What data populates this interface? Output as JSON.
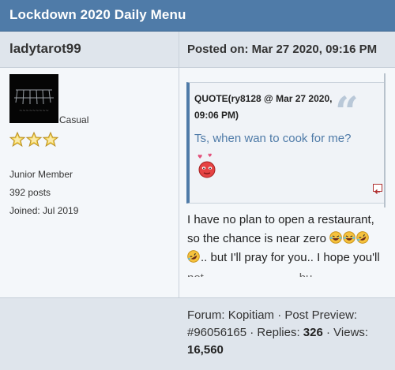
{
  "thread": {
    "title": "Lockdown 2020 Daily Menu"
  },
  "post": {
    "username": "ladytarot99",
    "posted_label": "Posted on: Mar 27 2020, 09:16 PM",
    "rank": "Casual",
    "member_group": "Junior Member",
    "post_count": "392 posts",
    "joined": "Joined: Jul 2019",
    "quote": {
      "header": "QUOTE(ry8128 @ Mar 27 2020, 09:06 PM)",
      "text": "Ts, when wan to cook for me?",
      "quote_icon": "quote-mark-icon",
      "expand_icon": "expand-icon"
    },
    "message": {
      "line1": "I have no plan to open a restaurant,",
      "line2": "so the chance is near zero",
      "line3": ".. but I'll pray for you.. I hope you'll",
      "cut_line": "not ... ... ... ... ... ... ... bu..."
    },
    "rating_stars": 3,
    "rating_max": 3
  },
  "footer": {
    "forum_label": "Forum: ",
    "forum": "Kopitiam",
    "sep1": " · ",
    "preview_label": "Post Preview:",
    "post_id": "#96056165",
    "replies_label": " · Replies: ",
    "replies": "326",
    "views_label": " · Views:",
    "views": "16,560"
  },
  "colors": {
    "titlebar": "#4f7ba8",
    "header_row": "#dfe5ec",
    "body": "#f4f7fa",
    "quote_text": "#4f7ba8",
    "star_fill": "#f3d24a"
  }
}
